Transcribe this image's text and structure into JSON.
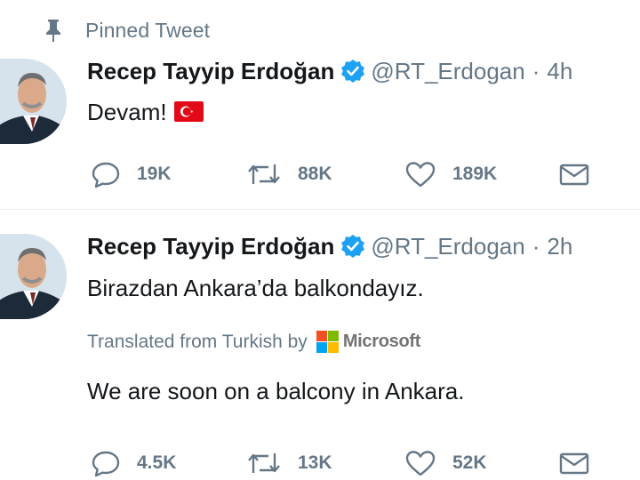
{
  "pinned": {
    "label": "Pinned Tweet"
  },
  "tweets": [
    {
      "author": {
        "name": "Recep Tayyip Erdoğan",
        "handle": "@RT_Erdogan",
        "time": "4h"
      },
      "text": "Devam!",
      "flag_emoji": "turkey-flag",
      "actions": {
        "replies": "19K",
        "retweets": "88K",
        "likes": "189K"
      }
    },
    {
      "author": {
        "name": "Recep Tayyip Erdoğan",
        "handle": "@RT_Erdogan",
        "time": "2h"
      },
      "text": "Birazdan Ankara’da balkondayız.",
      "translation": {
        "label": "Translated from Turkish by",
        "provider": "Microsoft",
        "text": "We are soon on a balcony in Ankara."
      },
      "actions": {
        "replies": "4.5K",
        "retweets": "13K",
        "likes": "52K"
      }
    }
  ],
  "colors": {
    "accent": "#1da1f2",
    "muted": "#657786",
    "text": "#14171a",
    "flag_red": "#e30a17",
    "divider": "#e6ecf0"
  }
}
